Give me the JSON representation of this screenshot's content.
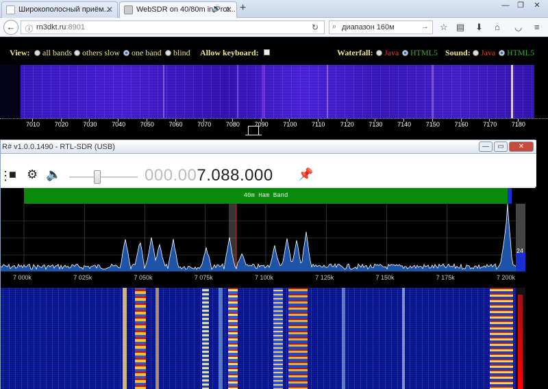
{
  "browser": {
    "tabs": [
      {
        "title": "Широкополосный приём..."
      },
      {
        "title": "WebSDR on 40/80m in Prot..."
      }
    ],
    "new_tab": "+",
    "url_host": "rn3dkt.ru",
    "url_port": ":8901",
    "search_text": "диапазон 160м"
  },
  "websdr": {
    "view_label": "View:",
    "view_options": [
      "all bands",
      "others slow",
      "one band",
      "blind"
    ],
    "view_selected": "one band",
    "allow_keyboard_label": "Allow keyboard:",
    "waterfall_label": "Waterfall:",
    "waterfall_options": [
      "Java",
      "HTML5"
    ],
    "sound_label": "Sound:",
    "sound_options": [
      "Java",
      "HTML5"
    ],
    "scale_ticks": [
      "7010",
      "7020",
      "7030",
      "7040",
      "7050",
      "7060",
      "7070",
      "7080",
      "7090",
      "7100",
      "7110",
      "7120",
      "7130",
      "7140",
      "7150",
      "7160",
      "7170",
      "7180"
    ]
  },
  "sdr": {
    "title": "R# v1.0.0.1490 - RTL-SDR (USB)",
    "freq_dim": "000.00",
    "freq_bright": "7.088.000",
    "band_label": "40m Ham Band",
    "gauge_value": "24",
    "x_labels": [
      "7 000k",
      "7 025k",
      "7 050k",
      "7 075k",
      "7 100k",
      "7 125k",
      "7 150k",
      "7 175k",
      "7 200k"
    ]
  },
  "colors": {
    "band_green": "#0a8a0a",
    "spectrum_blue": "#1a4fb0",
    "waterfall_bg": "#0b1a9c",
    "websdr_text": "#f0e68c"
  }
}
